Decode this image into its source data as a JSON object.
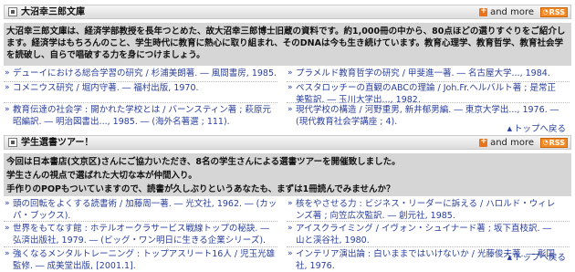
{
  "sections": [
    {
      "title": "大沼幸三郎文庫",
      "more_label": "and more",
      "rss_label": "RSS",
      "description": [
        "大沼幸三郎文庫は、経済学部教授を長年つとめた、故大沼幸三郎博士旧蔵の資料です。約1,000冊の中から、80点ほどの選りすぐりをご紹介します。経済学はもちろんのこと、学生時代に教育に熱心に取り組まれ、そのDNAは今も生き続けています。教育心理学、教育哲学、教育社会学を読破し、自らで唱破する力を身につけましょう。"
      ],
      "items": [
        "デューイにおける総合学習の研究 / 杉浦美朗著. ― 風間書房, 1985.",
        "プラメルド教育哲学の研究 / 甲斐進一著. ― 名古屋大学..., 1984.",
        "コメニウス研究 / 堀内守著. ― 福村出版, 1970.",
        "ペスタロッチーの直観のABCの理論 / Joh.Fr.ヘルバルト著 ; 是常正美監訳. ― 玉川大学出..., 1982.",
        "教育伝達の社会学 : 開かれた学校とは / バーンスティン著 ; 萩原元昭編訳. ― 明治図書出..., 1985. ― (海外名著選 ; 111).",
        "現代学校の構造 / 河野重男, 新井郁男編. ― 東京大学出..., 1976. ― (現代教育社会学講座 ; 4)."
      ],
      "back_to_top": "トップへ戻る"
    },
    {
      "title": "学生選書ツアー！",
      "more_label": "and more",
      "rss_label": "RSS",
      "description": [
        "今回は日本書店(文京区)さんにご協力いただき、8名の学生さんによる選書ツアーを開催致しました。",
        "学生さんの視点で選ばれた大切な本が仲間入り。",
        "手作りのPOPもついていますので、読書が久しぶりというあなたも、まずは1冊読んでみませんか？"
      ],
      "items": [
        "頭の回転をよくする読書術 / 加藤周一著. ― 光文社, 1962. ― (カッパ・ブックス).",
        "核をやさせる力 : ビジネス・リーダーに訴える / ハロルド・ウィレンズ著 ; 向笠広次監訳. ― 創元社, 1985.",
        "世界をもてなす館 : ホテルオークラサービス戦線トップの秘訣. ― 弘済出版社, 1979. ― (ビッグ・ワン明日に生きる企業シリーズ).",
        "アイスクライミング / イヴォン・シュイナード著 ; 坂下直枝訳. ― 山と渓谷社, 1980.",
        "強くなるメンタルトレーニング : トップアスリート16人 / 児玉光雄監修. ― 成美堂出版, [2001.1].",
        "インテリア演出論 : 白いままではいけないか / 光藤俊夫著. ― 彰国社, 1976."
      ],
      "back_to_top": "トップへ戻る"
    }
  ]
}
